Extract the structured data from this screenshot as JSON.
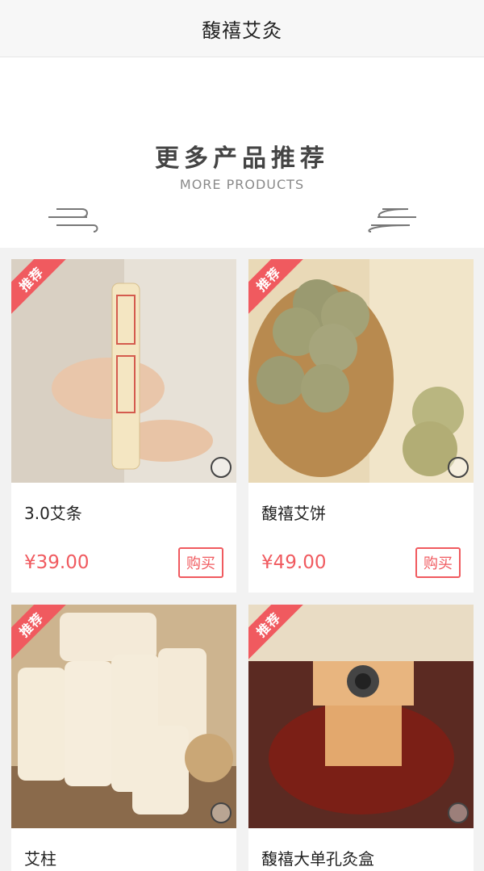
{
  "header": {
    "title": "馥禧艾灸"
  },
  "banner": {
    "title_cn": "更多产品推荐",
    "title_en": "MORE PRODUCTS"
  },
  "products": [
    {
      "name": "3.0艾条",
      "price": "¥39.00",
      "buy_label": "购买",
      "tag": "推荐"
    },
    {
      "name": "馥禧艾饼",
      "price": "¥49.00",
      "buy_label": "购买",
      "tag": "推荐"
    },
    {
      "name": "艾柱",
      "tag": "推荐"
    },
    {
      "name": "馥禧大单孔灸盒",
      "tag": "推荐"
    }
  ],
  "colors": {
    "accent": "#f05a5f",
    "bg": "#f2f2f2"
  },
  "icons": [
    "cloud-ornament-icon",
    "brand-seal-icon"
  ]
}
